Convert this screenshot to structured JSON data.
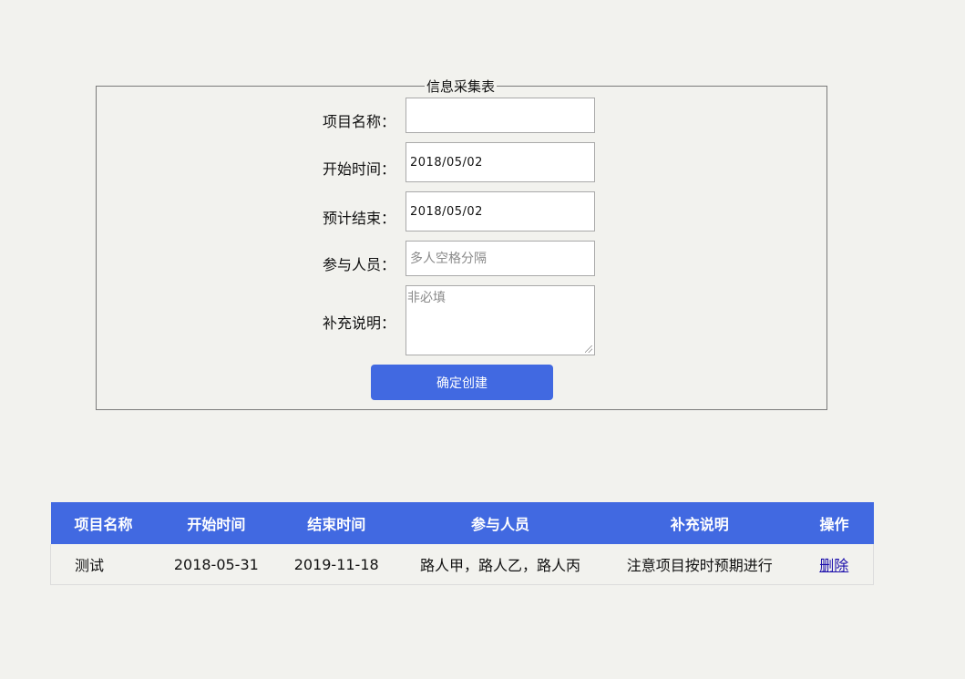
{
  "form": {
    "legend": "信息采集表",
    "fields": [
      {
        "label": "项目名称：",
        "value": "",
        "placeholder": ""
      },
      {
        "label": "开始时间：",
        "value": "2018/05/02",
        "placeholder": ""
      },
      {
        "label": "预计结束：",
        "value": "2018/05/02",
        "placeholder": ""
      },
      {
        "label": "参与人员：",
        "value": "",
        "placeholder": "多人空格分隔"
      },
      {
        "label": "补充说明：",
        "value": "",
        "placeholder": "非必填"
      }
    ],
    "submit_label": "确定创建"
  },
  "table": {
    "headers": [
      "项目名称",
      "开始时间",
      "结束时间",
      "参与人员",
      "补充说明",
      "操作"
    ],
    "rows": [
      {
        "name": "测试",
        "start": "2018-05-31",
        "end": "2019-11-18",
        "members": "路人甲，路人乙，路人丙",
        "note": "注意项目按时预期进行",
        "action": "删除"
      }
    ]
  },
  "colors": {
    "accent": "#4169e1",
    "background": "#f2f2ee"
  }
}
